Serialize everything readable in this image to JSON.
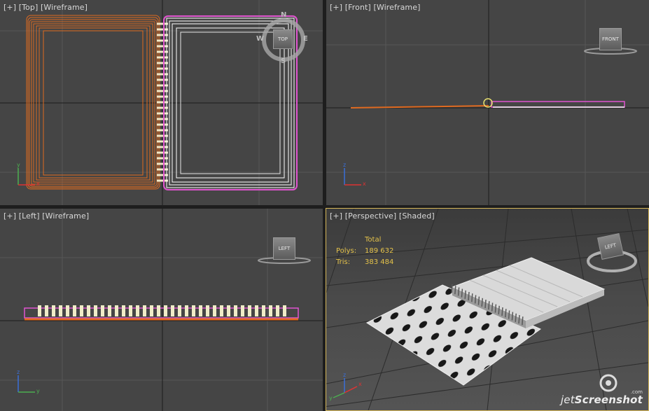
{
  "viewports": {
    "top": {
      "plus": "[+]",
      "view": "[Top]",
      "mode": "[Wireframe]",
      "cube_label": "TOP",
      "compass": {
        "n": "N",
        "s": "S",
        "e": "E",
        "w": "W"
      }
    },
    "front": {
      "plus": "[+]",
      "view": "[Front]",
      "mode": "[Wireframe]",
      "cube_label": "FRONT"
    },
    "left": {
      "plus": "[+]",
      "view": "[Left]",
      "mode": "[Wireframe]",
      "cube_label": "LEFT"
    },
    "perspective": {
      "plus": "[+]",
      "view": "[Perspective]",
      "mode": "[Shaded]",
      "cube_label": "LEFT",
      "stats": {
        "header": "Total",
        "polys_label": "Polys:",
        "polys_value": "189 632",
        "tris_label": "Tris:",
        "tris_value": "383 484"
      }
    }
  },
  "axis_labels": {
    "x": "x",
    "y": "y",
    "z": "z"
  },
  "watermark": {
    "prefix": "jet",
    "brand": "Screenshot",
    "suffix": ".com"
  },
  "colors": {
    "viewport_bg": "#454545",
    "active_border": "#d6b75a",
    "orange_wire": "#e06a20",
    "pink_wire": "#e055d0",
    "stats_text": "#e4c24a"
  }
}
